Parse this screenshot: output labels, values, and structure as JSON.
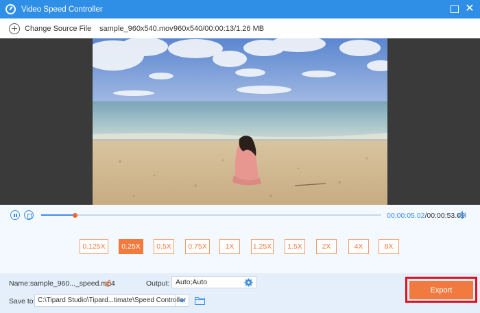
{
  "window": {
    "title": "Video Speed Controller"
  },
  "toolbar": {
    "change_source_label": "Change Source File",
    "filename": "sample_960x540.mov",
    "fileinfo": "960x540/00:00:13/1.26 MB"
  },
  "playback": {
    "current_time": "00:00:05.02",
    "separator": "/",
    "total_time": "00:00:53.09",
    "progress_percent": 10
  },
  "speed_options": [
    "0.125X",
    "0.25X",
    "0.5X",
    "0.75X",
    "1X",
    "1.25X",
    "1.5X",
    "2X",
    "4X",
    "8X"
  ],
  "selected_speed": "0.25X",
  "settings": {
    "name_label": "Name:",
    "name_value": "sample_960..._speed.mp4",
    "output_label": "Output:",
    "output_value": "Auto;Auto",
    "save_to_label": "Save to:",
    "save_to_value": "C:\\Tipard Studio\\Tipard...timate\\Speed Controller"
  },
  "export": {
    "label": "Export"
  },
  "colors": {
    "accent": "#2f8fe6",
    "speed_accent": "#f37a3d",
    "export_highlight": "#e0101c"
  }
}
